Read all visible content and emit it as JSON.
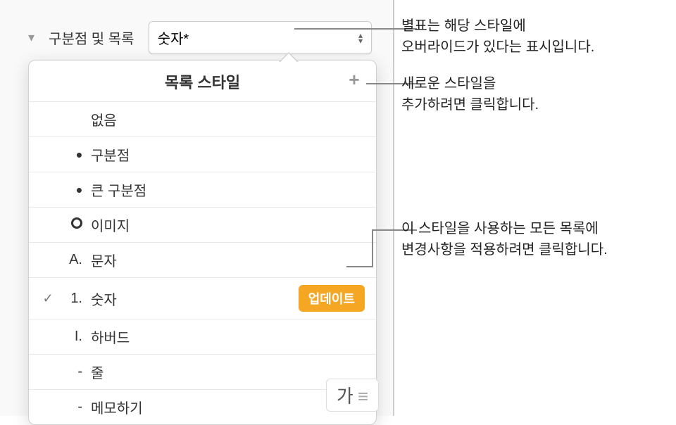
{
  "section": {
    "label": "구분점 및 목록",
    "popup_value": "숫자*"
  },
  "popover": {
    "title": "목록 스타일",
    "add_icon": "+"
  },
  "styles": [
    {
      "marker": "",
      "label": "없음",
      "checked": false,
      "marker_class": ""
    },
    {
      "marker": "•",
      "label": "구분점",
      "checked": false,
      "marker_class": "dot"
    },
    {
      "marker": "•",
      "label": "큰 구분점",
      "checked": false,
      "marker_class": "dot"
    },
    {
      "marker": "IMG",
      "label": "이미지",
      "checked": false,
      "marker_class": "image"
    },
    {
      "marker": "A.",
      "label": "문자",
      "checked": false,
      "marker_class": ""
    },
    {
      "marker": "1.",
      "label": "숫자",
      "checked": true,
      "marker_class": "",
      "update": true
    },
    {
      "marker": "I.",
      "label": "하버드",
      "checked": false,
      "marker_class": ""
    },
    {
      "marker": "-",
      "label": "줄",
      "checked": false,
      "marker_class": ""
    },
    {
      "marker": "-",
      "label": "메모하기",
      "checked": false,
      "marker_class": ""
    }
  ],
  "update_label": "업데이트",
  "callouts": {
    "asterisk_l1": "별표는 해당 스타일에",
    "asterisk_l2": "오버라이드가 있다는 표시입니다.",
    "add_l1": "새로운 스타일을",
    "add_l2": "추가하려면 클릭합니다.",
    "update_l1": "이 스타일을 사용하는 모든 목록에",
    "update_l2": "변경사항을 적용하려면 클릭합니다."
  },
  "bottom_text": "가"
}
